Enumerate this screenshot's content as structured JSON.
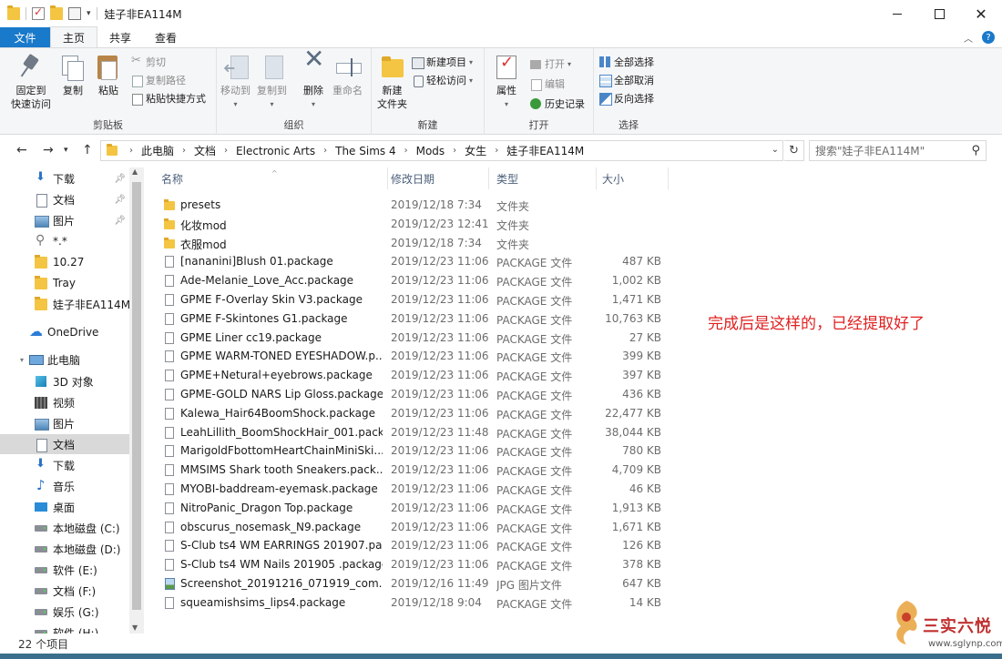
{
  "window": {
    "title": "娃子非EA114M"
  },
  "ribbon_tabs": [
    "文件",
    "主页",
    "共享",
    "查看"
  ],
  "ribbon": {
    "clipboard": {
      "pin_label_1": "固定到",
      "pin_label_2": "快速访问",
      "copy": "复制",
      "paste": "粘贴",
      "cut": "剪切",
      "copy_path": "复制路径",
      "paste_shortcut": "粘贴快捷方式",
      "group": "剪贴板"
    },
    "organize": {
      "move_to": "移动到",
      "copy_to": "复制到",
      "delete": "删除",
      "rename": "重命名",
      "group": "组织"
    },
    "new": {
      "new_folder_1": "新建",
      "new_folder_2": "文件夹",
      "new_item": "新建项目",
      "easy_access": "轻松访问",
      "group": "新建"
    },
    "open": {
      "properties": "属性",
      "open": "打开",
      "edit": "编辑",
      "history": "历史记录",
      "group": "打开"
    },
    "select": {
      "select_all": "全部选择",
      "select_none": "全部取消",
      "invert": "反向选择",
      "group": "选择"
    }
  },
  "address": {
    "crumbs": [
      "此电脑",
      "文档",
      "Electronic Arts",
      "The Sims 4",
      "Mods",
      "女生",
      "娃子非EA114M"
    ],
    "search_placeholder": "搜索\"娃子非EA114M\""
  },
  "nav_pane": {
    "quick": [
      {
        "label": "下载",
        "icon": "download-icon",
        "pinned": true
      },
      {
        "label": "文档",
        "icon": "document-icon",
        "pinned": true
      },
      {
        "label": "图片",
        "icon": "picture-icon",
        "pinned": true
      },
      {
        "label": "*.*",
        "icon": "search-icon",
        "pinned": false
      },
      {
        "label": "10.27",
        "icon": "folder-icon",
        "pinned": false
      },
      {
        "label": "Tray",
        "icon": "folder-icon",
        "pinned": false
      },
      {
        "label": "娃子非EA114M",
        "icon": "folder-icon",
        "pinned": false
      }
    ],
    "onedrive": "OneDrive",
    "this_pc": "此电脑",
    "pc_items": [
      "3D 对象",
      "视频",
      "图片",
      "文档",
      "下载",
      "音乐",
      "桌面",
      "本地磁盘 (C:)",
      "本地磁盘 (D:)",
      "软件 (E:)",
      "文档 (F:)",
      "娱乐 (G:)",
      "软件 (H:)"
    ]
  },
  "columns": {
    "name": "名称",
    "date": "修改日期",
    "type": "类型",
    "size": "大小"
  },
  "files": [
    {
      "name": "presets",
      "date": "2019/12/18 7:34",
      "type": "文件夹",
      "size": "",
      "kind": "folder"
    },
    {
      "name": "化妆mod",
      "date": "2019/12/23 12:41",
      "type": "文件夹",
      "size": "",
      "kind": "folder"
    },
    {
      "name": "衣服mod",
      "date": "2019/12/18 7:34",
      "type": "文件夹",
      "size": "",
      "kind": "folder"
    },
    {
      "name": "[nananini]Blush 01.package",
      "date": "2019/12/23 11:06",
      "type": "PACKAGE 文件",
      "size": "487 KB",
      "kind": "pkg"
    },
    {
      "name": "Ade-Melanie_Love_Acc.package",
      "date": "2019/12/23 11:06",
      "type": "PACKAGE 文件",
      "size": "1,002 KB",
      "kind": "pkg"
    },
    {
      "name": "GPME F-Overlay Skin V3.package",
      "date": "2019/12/23 11:06",
      "type": "PACKAGE 文件",
      "size": "1,471 KB",
      "kind": "pkg"
    },
    {
      "name": "GPME F-Skintones G1.package",
      "date": "2019/12/23 11:06",
      "type": "PACKAGE 文件",
      "size": "10,763 KB",
      "kind": "pkg"
    },
    {
      "name": "GPME Liner cc19.package",
      "date": "2019/12/23 11:06",
      "type": "PACKAGE 文件",
      "size": "27 KB",
      "kind": "pkg"
    },
    {
      "name": "GPME WARM-TONED EYESHADOW.p...",
      "date": "2019/12/23 11:06",
      "type": "PACKAGE 文件",
      "size": "399 KB",
      "kind": "pkg"
    },
    {
      "name": "GPME+Netural+eyebrows.package",
      "date": "2019/12/23 11:06",
      "type": "PACKAGE 文件",
      "size": "397 KB",
      "kind": "pkg"
    },
    {
      "name": "GPME-GOLD NARS Lip Gloss.package",
      "date": "2019/12/23 11:06",
      "type": "PACKAGE 文件",
      "size": "436 KB",
      "kind": "pkg"
    },
    {
      "name": "Kalewa_Hair64BoomShock.package",
      "date": "2019/12/23 11:06",
      "type": "PACKAGE 文件",
      "size": "22,477 KB",
      "kind": "pkg"
    },
    {
      "name": "LeahLillith_BoomShockHair_001.pack...",
      "date": "2019/12/23 11:48",
      "type": "PACKAGE 文件",
      "size": "38,044 KB",
      "kind": "pkg"
    },
    {
      "name": "MarigoldFbottomHeartChainMiniSki...",
      "date": "2019/12/23 11:06",
      "type": "PACKAGE 文件",
      "size": "780 KB",
      "kind": "pkg"
    },
    {
      "name": "MMSIMS Shark tooth Sneakers.pack...",
      "date": "2019/12/23 11:06",
      "type": "PACKAGE 文件",
      "size": "4,709 KB",
      "kind": "pkg"
    },
    {
      "name": "MYOBI-baddream-eyemask.package",
      "date": "2019/12/23 11:06",
      "type": "PACKAGE 文件",
      "size": "46 KB",
      "kind": "pkg"
    },
    {
      "name": "NitroPanic_Dragon Top.package",
      "date": "2019/12/23 11:06",
      "type": "PACKAGE 文件",
      "size": "1,913 KB",
      "kind": "pkg"
    },
    {
      "name": "obscurus_nosemask_N9.package",
      "date": "2019/12/23 11:06",
      "type": "PACKAGE 文件",
      "size": "1,671 KB",
      "kind": "pkg"
    },
    {
      "name": "S-Club ts4 WM EARRINGS 201907.pa...",
      "date": "2019/12/23 11:06",
      "type": "PACKAGE 文件",
      "size": "126 KB",
      "kind": "pkg"
    },
    {
      "name": "S-Club ts4 WM Nails 201905 .package",
      "date": "2019/12/23 11:06",
      "type": "PACKAGE 文件",
      "size": "378 KB",
      "kind": "pkg"
    },
    {
      "name": "Screenshot_20191216_071919_com....",
      "date": "2019/12/16 11:49",
      "type": "JPG 图片文件",
      "size": "647 KB",
      "kind": "jpg"
    },
    {
      "name": "squeamishsims_lips4.package",
      "date": "2019/12/18 9:04",
      "type": "PACKAGE 文件",
      "size": "14 KB",
      "kind": "pkg"
    }
  ],
  "annotation": "完成后是这样的，已经提取好了",
  "status": "22 个项目",
  "watermark": {
    "text": "三实六悦",
    "url": "www.sglynp.com"
  },
  "colors": {
    "file_tab": "#1979ca",
    "annotation": "#e02020",
    "folder": "#f4c542"
  }
}
